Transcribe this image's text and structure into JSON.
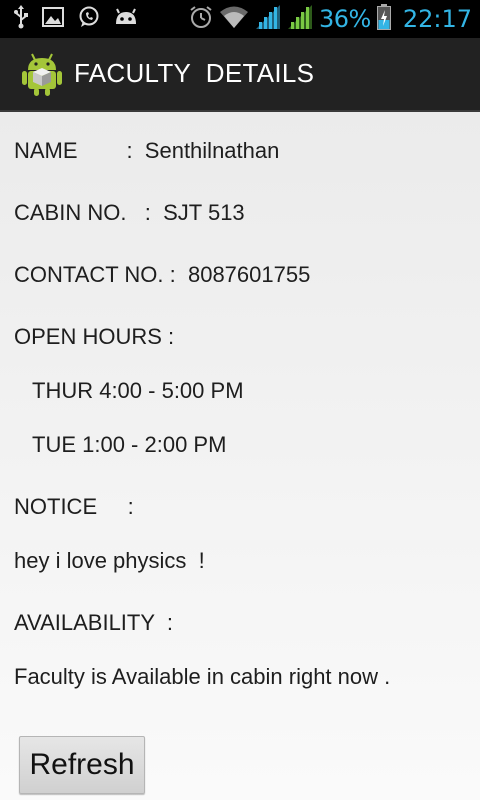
{
  "status_bar": {
    "left_icons": [
      "usb-icon",
      "image-icon",
      "whatsapp-icon",
      "android-debug-icon"
    ],
    "right_icons": [
      "alarm-icon",
      "wifi-icon",
      "signal-icon",
      "signal-icon",
      "battery-charging-icon"
    ],
    "battery": "36%",
    "time": "22:17",
    "accent_color": "#33b5e5"
  },
  "action_bar": {
    "icon": "android-cube-icon",
    "title": "FACULTY  DETAILS"
  },
  "details": {
    "name": "NAME        :  Senthilnathan",
    "cabin": "CABIN NO.   :  SJT 513",
    "contact": "CONTACT NO. :  8087601755",
    "open_hours_label": "OPEN HOURS :",
    "hours": [
      "THUR 4:00 - 5:00 PM",
      "TUE 1:00 - 2:00 PM"
    ],
    "notice_label": "NOTICE     :",
    "notice_text": "hey i love physics  !",
    "availability_label": "AVAILABILITY  :",
    "availability_text": "Faculty is Available in cabin right now ."
  },
  "refresh_button": {
    "label": "Refresh"
  }
}
